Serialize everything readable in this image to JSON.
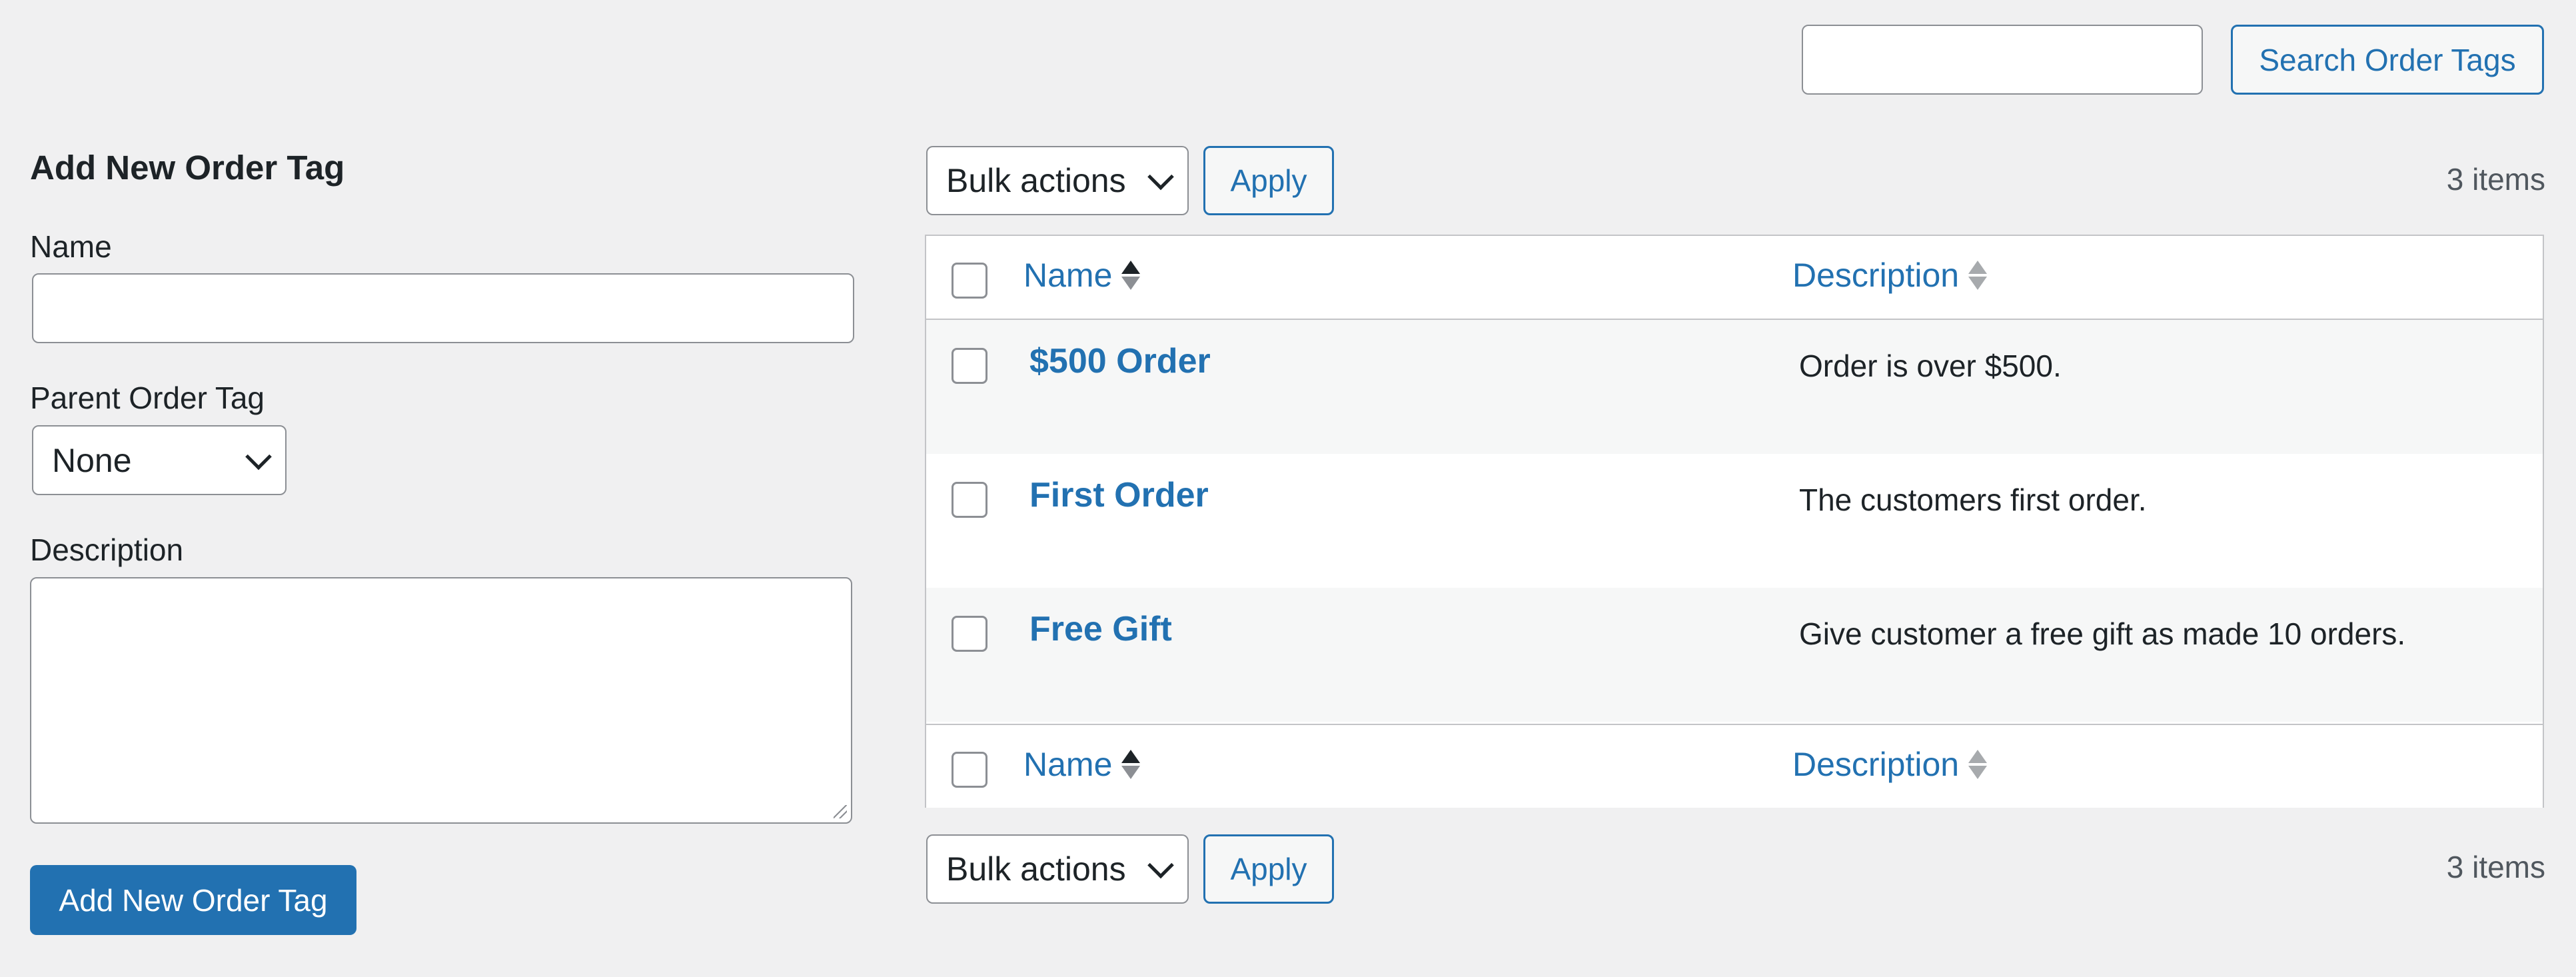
{
  "search": {
    "placeholder": "",
    "button_label": "Search Order Tags"
  },
  "form": {
    "title": "Add New Order Tag",
    "name_label": "Name",
    "name_value": "",
    "parent_label": "Parent Order Tag",
    "parent_selected": "None",
    "description_label": "Description",
    "description_value": "",
    "submit_label": "Add New Order Tag"
  },
  "tablenav_top": {
    "bulk_actions": "Bulk actions",
    "apply_label": "Apply",
    "items_count": "3 items"
  },
  "tablenav_bottom": {
    "bulk_actions": "Bulk actions",
    "apply_label": "Apply",
    "items_count": "3 items"
  },
  "table": {
    "columns": [
      "Name",
      "Description"
    ],
    "rows": [
      {
        "name": "$500 Order",
        "description": "Order is over $500."
      },
      {
        "name": "First Order",
        "description": "The customers first order."
      },
      {
        "name": "Free Gift",
        "description": "Give customer a free gift as made 10 orders."
      }
    ]
  },
  "colors": {
    "accent": "#2271b1",
    "background": "#f0f0f1"
  }
}
